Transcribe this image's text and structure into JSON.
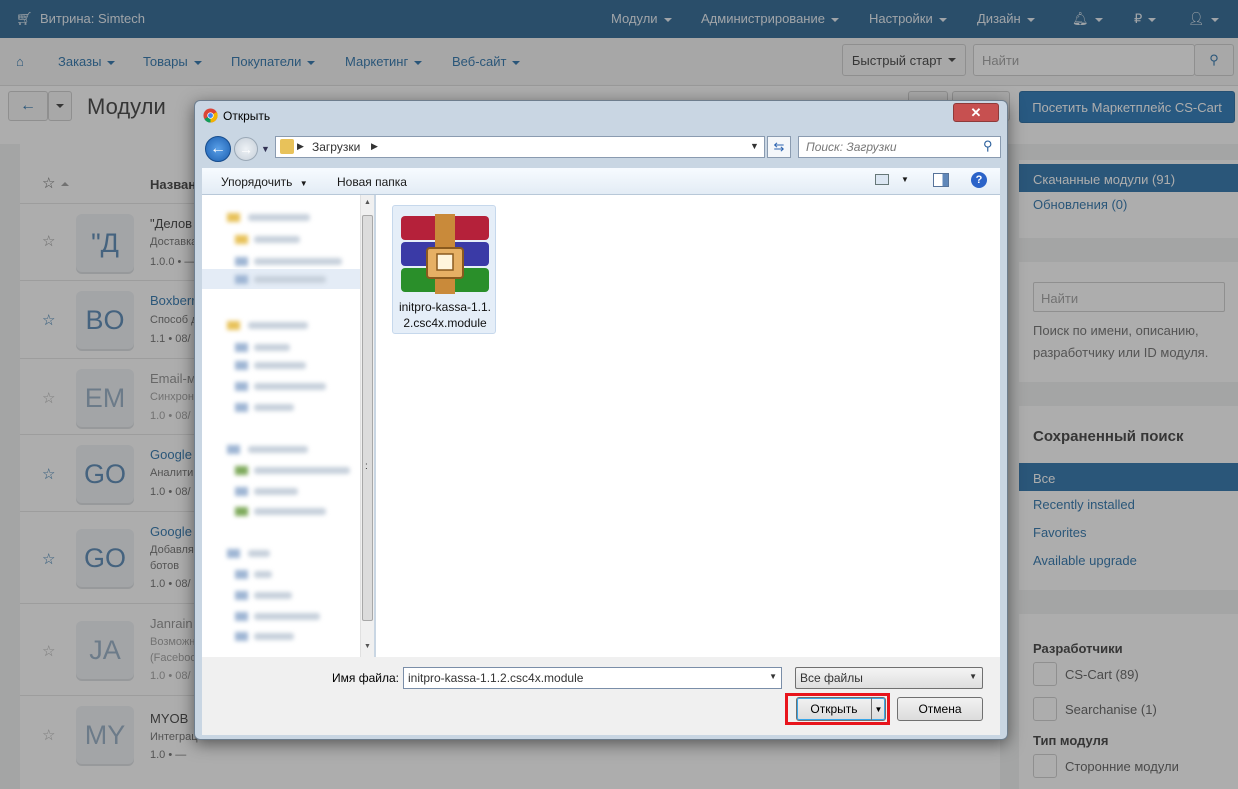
{
  "topbar": {
    "store": "Витрина: Simtech",
    "items": [
      "Модули",
      "Администрирование",
      "Настройки",
      "Дизайн"
    ],
    "currency": "₽"
  },
  "nav": {
    "items": [
      "Заказы",
      "Товары",
      "Покупатели",
      "Маркетинг",
      "Веб-сайт"
    ],
    "quickstart": "Быстрый старт",
    "search_placeholder": "Найти"
  },
  "header": {
    "title": "Модули",
    "marketplace_button": "Посетить Маркетплейс CS-Cart"
  },
  "list": {
    "name_header": "Назван",
    "rows": [
      {
        "avatar": "\"Д",
        "name": "\"Делов",
        "desc": "Доставка",
        "meta": "1.0.0 • —"
      },
      {
        "avatar": "BO",
        "name": "Boxberr",
        "desc": "Способ д",
        "meta": "1.1 • 08/"
      },
      {
        "avatar": "EM",
        "name": "Email-м",
        "desc": "Синхрон",
        "meta": "1.0 • 08/"
      },
      {
        "avatar": "GO",
        "name": "Google",
        "desc": "Аналити",
        "meta": "1.0 • 08/"
      },
      {
        "avatar": "GO",
        "name": "Google",
        "desc": "Добавля",
        "desc2": "ботов",
        "meta": "1.0 • 08/"
      },
      {
        "avatar": "JA",
        "name": "Janrain",
        "desc": "Возможн",
        "desc2": "(Faceboo",
        "meta": "1.0 • 08/"
      },
      {
        "avatar": "MY",
        "name": "MYOB",
        "desc": "Интеграц",
        "meta": "1.0 • —"
      }
    ]
  },
  "sidebar": {
    "downloaded": "Скачанные модули (91)",
    "updates": "Обновления (0)",
    "search_placeholder": "Найти",
    "search_hint": "Поиск по имени, описанию, разработчику или ID модуля.",
    "saved_search_title": "Сохраненный поиск",
    "saved": [
      "Все",
      "Recently installed",
      "Favorites",
      "Available upgrade"
    ],
    "developers_title": "Разработчики",
    "developers": [
      "CS-Cart (89)",
      "Searchanise (1)"
    ],
    "module_type_title": "Тип модуля",
    "module_types": [
      "Сторонние модули"
    ]
  },
  "dialog": {
    "title": "Открыть",
    "path": "Загрузки",
    "search_placeholder": "Поиск: Загрузки",
    "organize": "Упорядочить",
    "new_folder": "Новая папка",
    "file_name_line1": "initpro-kassa-1.1.",
    "file_name_line2": "2.csc4x.module",
    "filename_label": "Имя файла:",
    "filename_value": "initpro-kassa-1.1.2.csc4x.module",
    "filter": "Все файлы",
    "open": "Открыть",
    "cancel": "Отмена",
    "highlight_color": "#e8141c"
  }
}
